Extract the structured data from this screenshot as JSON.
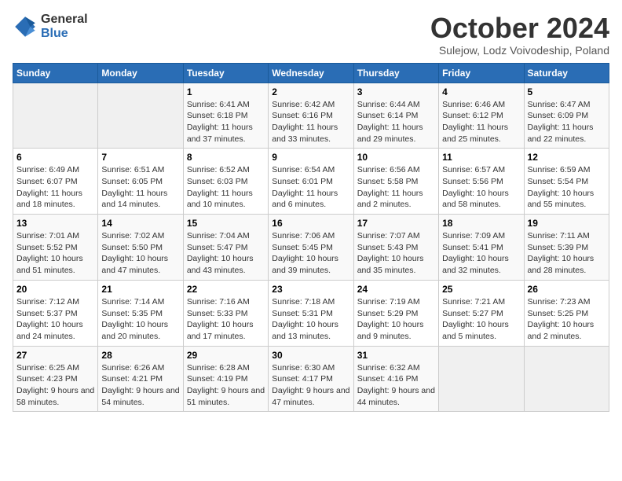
{
  "header": {
    "logo_general": "General",
    "logo_blue": "Blue",
    "month_title": "October 2024",
    "location": "Sulejow, Lodz Voivodeship, Poland"
  },
  "weekdays": [
    "Sunday",
    "Monday",
    "Tuesday",
    "Wednesday",
    "Thursday",
    "Friday",
    "Saturday"
  ],
  "weeks": [
    [
      {
        "day": "",
        "empty": true
      },
      {
        "day": "",
        "empty": true
      },
      {
        "day": "1",
        "sunrise": "Sunrise: 6:41 AM",
        "sunset": "Sunset: 6:18 PM",
        "daylight": "Daylight: 11 hours and 37 minutes."
      },
      {
        "day": "2",
        "sunrise": "Sunrise: 6:42 AM",
        "sunset": "Sunset: 6:16 PM",
        "daylight": "Daylight: 11 hours and 33 minutes."
      },
      {
        "day": "3",
        "sunrise": "Sunrise: 6:44 AM",
        "sunset": "Sunset: 6:14 PM",
        "daylight": "Daylight: 11 hours and 29 minutes."
      },
      {
        "day": "4",
        "sunrise": "Sunrise: 6:46 AM",
        "sunset": "Sunset: 6:12 PM",
        "daylight": "Daylight: 11 hours and 25 minutes."
      },
      {
        "day": "5",
        "sunrise": "Sunrise: 6:47 AM",
        "sunset": "Sunset: 6:09 PM",
        "daylight": "Daylight: 11 hours and 22 minutes."
      }
    ],
    [
      {
        "day": "6",
        "sunrise": "Sunrise: 6:49 AM",
        "sunset": "Sunset: 6:07 PM",
        "daylight": "Daylight: 11 hours and 18 minutes."
      },
      {
        "day": "7",
        "sunrise": "Sunrise: 6:51 AM",
        "sunset": "Sunset: 6:05 PM",
        "daylight": "Daylight: 11 hours and 14 minutes."
      },
      {
        "day": "8",
        "sunrise": "Sunrise: 6:52 AM",
        "sunset": "Sunset: 6:03 PM",
        "daylight": "Daylight: 11 hours and 10 minutes."
      },
      {
        "day": "9",
        "sunrise": "Sunrise: 6:54 AM",
        "sunset": "Sunset: 6:01 PM",
        "daylight": "Daylight: 11 hours and 6 minutes."
      },
      {
        "day": "10",
        "sunrise": "Sunrise: 6:56 AM",
        "sunset": "Sunset: 5:58 PM",
        "daylight": "Daylight: 11 hours and 2 minutes."
      },
      {
        "day": "11",
        "sunrise": "Sunrise: 6:57 AM",
        "sunset": "Sunset: 5:56 PM",
        "daylight": "Daylight: 10 hours and 58 minutes."
      },
      {
        "day": "12",
        "sunrise": "Sunrise: 6:59 AM",
        "sunset": "Sunset: 5:54 PM",
        "daylight": "Daylight: 10 hours and 55 minutes."
      }
    ],
    [
      {
        "day": "13",
        "sunrise": "Sunrise: 7:01 AM",
        "sunset": "Sunset: 5:52 PM",
        "daylight": "Daylight: 10 hours and 51 minutes."
      },
      {
        "day": "14",
        "sunrise": "Sunrise: 7:02 AM",
        "sunset": "Sunset: 5:50 PM",
        "daylight": "Daylight: 10 hours and 47 minutes."
      },
      {
        "day": "15",
        "sunrise": "Sunrise: 7:04 AM",
        "sunset": "Sunset: 5:47 PM",
        "daylight": "Daylight: 10 hours and 43 minutes."
      },
      {
        "day": "16",
        "sunrise": "Sunrise: 7:06 AM",
        "sunset": "Sunset: 5:45 PM",
        "daylight": "Daylight: 10 hours and 39 minutes."
      },
      {
        "day": "17",
        "sunrise": "Sunrise: 7:07 AM",
        "sunset": "Sunset: 5:43 PM",
        "daylight": "Daylight: 10 hours and 35 minutes."
      },
      {
        "day": "18",
        "sunrise": "Sunrise: 7:09 AM",
        "sunset": "Sunset: 5:41 PM",
        "daylight": "Daylight: 10 hours and 32 minutes."
      },
      {
        "day": "19",
        "sunrise": "Sunrise: 7:11 AM",
        "sunset": "Sunset: 5:39 PM",
        "daylight": "Daylight: 10 hours and 28 minutes."
      }
    ],
    [
      {
        "day": "20",
        "sunrise": "Sunrise: 7:12 AM",
        "sunset": "Sunset: 5:37 PM",
        "daylight": "Daylight: 10 hours and 24 minutes."
      },
      {
        "day": "21",
        "sunrise": "Sunrise: 7:14 AM",
        "sunset": "Sunset: 5:35 PM",
        "daylight": "Daylight: 10 hours and 20 minutes."
      },
      {
        "day": "22",
        "sunrise": "Sunrise: 7:16 AM",
        "sunset": "Sunset: 5:33 PM",
        "daylight": "Daylight: 10 hours and 17 minutes."
      },
      {
        "day": "23",
        "sunrise": "Sunrise: 7:18 AM",
        "sunset": "Sunset: 5:31 PM",
        "daylight": "Daylight: 10 hours and 13 minutes."
      },
      {
        "day": "24",
        "sunrise": "Sunrise: 7:19 AM",
        "sunset": "Sunset: 5:29 PM",
        "daylight": "Daylight: 10 hours and 9 minutes."
      },
      {
        "day": "25",
        "sunrise": "Sunrise: 7:21 AM",
        "sunset": "Sunset: 5:27 PM",
        "daylight": "Daylight: 10 hours and 5 minutes."
      },
      {
        "day": "26",
        "sunrise": "Sunrise: 7:23 AM",
        "sunset": "Sunset: 5:25 PM",
        "daylight": "Daylight: 10 hours and 2 minutes."
      }
    ],
    [
      {
        "day": "27",
        "sunrise": "Sunrise: 6:25 AM",
        "sunset": "Sunset: 4:23 PM",
        "daylight": "Daylight: 9 hours and 58 minutes."
      },
      {
        "day": "28",
        "sunrise": "Sunrise: 6:26 AM",
        "sunset": "Sunset: 4:21 PM",
        "daylight": "Daylight: 9 hours and 54 minutes."
      },
      {
        "day": "29",
        "sunrise": "Sunrise: 6:28 AM",
        "sunset": "Sunset: 4:19 PM",
        "daylight": "Daylight: 9 hours and 51 minutes."
      },
      {
        "day": "30",
        "sunrise": "Sunrise: 6:30 AM",
        "sunset": "Sunset: 4:17 PM",
        "daylight": "Daylight: 9 hours and 47 minutes."
      },
      {
        "day": "31",
        "sunrise": "Sunrise: 6:32 AM",
        "sunset": "Sunset: 4:16 PM",
        "daylight": "Daylight: 9 hours and 44 minutes."
      },
      {
        "day": "",
        "empty": true
      },
      {
        "day": "",
        "empty": true
      }
    ]
  ]
}
